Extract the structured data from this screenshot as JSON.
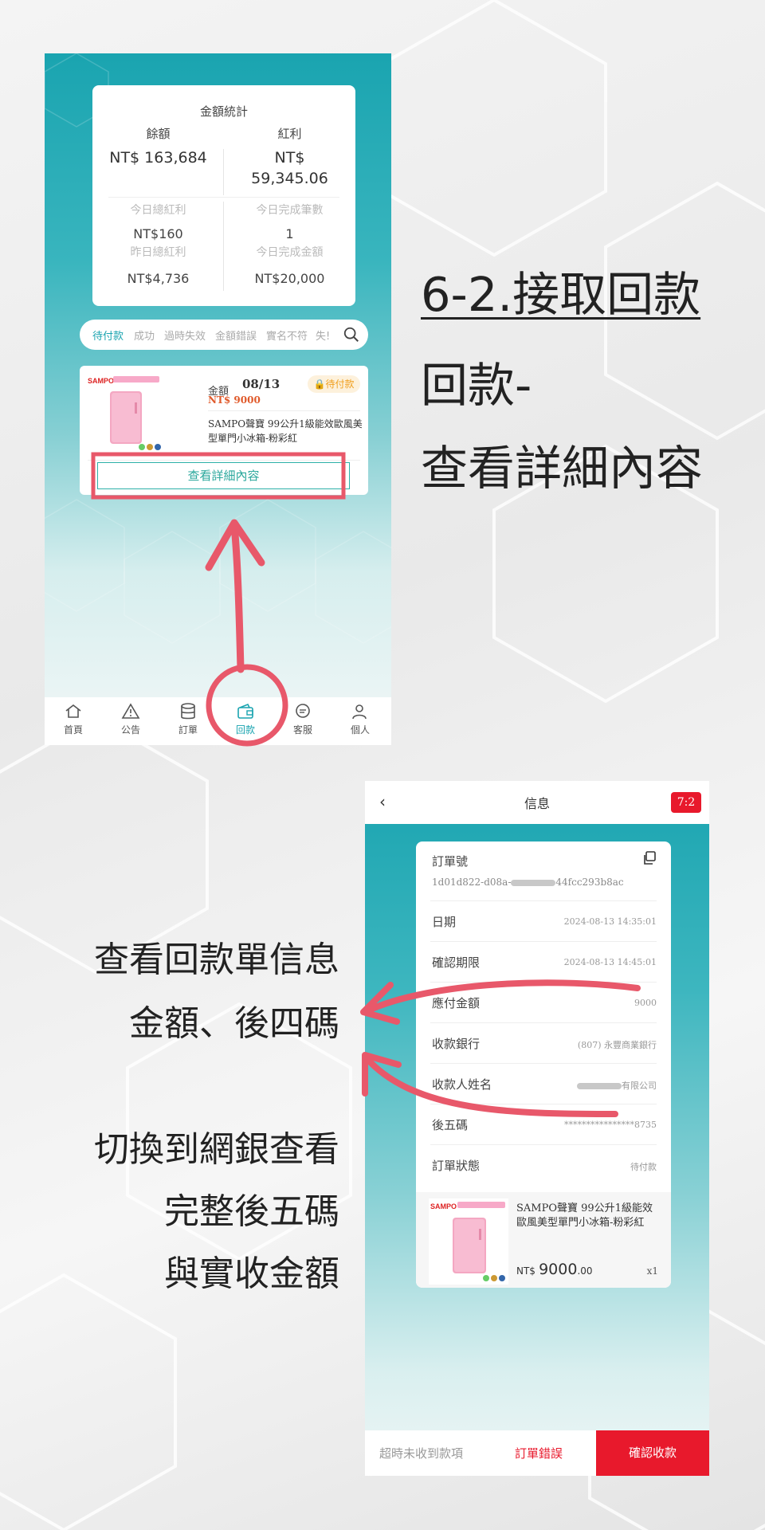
{
  "phone1": {
    "stats": {
      "title": "金額統計",
      "balance_label": "餘額",
      "balance_value": "NT$ 163,684",
      "bonus_label": "紅利",
      "bonus_value_line1": "NT$",
      "bonus_value_line2": "59,345.06",
      "today_bonus_label": "今日總紅利",
      "today_bonus_value": "NT$160",
      "yesterday_bonus_label": "昨日總紅利",
      "yesterday_bonus_value": "NT$4,736",
      "today_count_label": "今日完成筆數",
      "today_count_value": "1",
      "today_amount_label": "今日完成金額",
      "today_amount_value": "NT$20,000"
    },
    "tabs": [
      "待付款",
      "成功",
      "過時失效",
      "金額錯誤",
      "實名不符",
      "失!"
    ],
    "order": {
      "brand": "SAMPO",
      "amount_label": "金額",
      "date": "08/13",
      "amount": "NT$ 9000",
      "status": "待付款",
      "product_name": "SAMPO聲寶 99公升1級能效歐風美型單門小冰箱-粉彩紅",
      "detail_button": "查看詳細內容"
    },
    "nav": [
      {
        "label": "首頁",
        "icon": "home-icon"
      },
      {
        "label": "公告",
        "icon": "alert-icon"
      },
      {
        "label": "訂單",
        "icon": "database-icon"
      },
      {
        "label": "回款",
        "icon": "wallet-icon"
      },
      {
        "label": "客服",
        "icon": "chat-icon"
      },
      {
        "label": "個人",
        "icon": "user-icon"
      }
    ],
    "active_nav": "回款"
  },
  "phone2": {
    "header": {
      "back": "‹",
      "title": "信息",
      "timer": "7:2"
    },
    "order_no_label": "訂單號",
    "order_no_prefix": "1d01d822-d08a-",
    "order_no_suffix": "44fcc293b8ac",
    "rows": [
      {
        "label": "日期",
        "value": "2024-08-13 14:35:01"
      },
      {
        "label": "確認期限",
        "value": "2024-08-13 14:45:01"
      },
      {
        "label": "應付金額",
        "value": "9000"
      },
      {
        "label": "收款銀行",
        "value": "(807) 永豐商業銀行"
      },
      {
        "label": "收款人姓名",
        "value": "有限公司"
      },
      {
        "label": "後五碼",
        "value": "****************8735"
      },
      {
        "label": "訂單狀態",
        "value": "待付款"
      }
    ],
    "product": {
      "brand": "SAMPO",
      "name": "SAMPO聲寶 99公升1級能效歐風美型單門小冰箱-粉彩紅",
      "price_prefix": "NT$",
      "price_main": "9000",
      "price_dec": ".00",
      "qty": "x1"
    },
    "footer": {
      "timeout": "超時未收到款項",
      "error": "訂單錯誤",
      "confirm": "確認收款"
    }
  },
  "annotations": {
    "title": "6-2.接取回款",
    "line2": "回款-",
    "line3": "查看詳細內容",
    "note1_line1": "查看回款單信息",
    "note1_line2": "金額、後四碼",
    "note2_line1": "切換到網銀查看",
    "note2_line2": "完整後五碼",
    "note2_line3": "與實收金額"
  },
  "colors": {
    "teal": "#1aa4b0",
    "red": "#e8192c",
    "annotation_red": "#e8586a",
    "badge_orange": "#f0a020"
  }
}
